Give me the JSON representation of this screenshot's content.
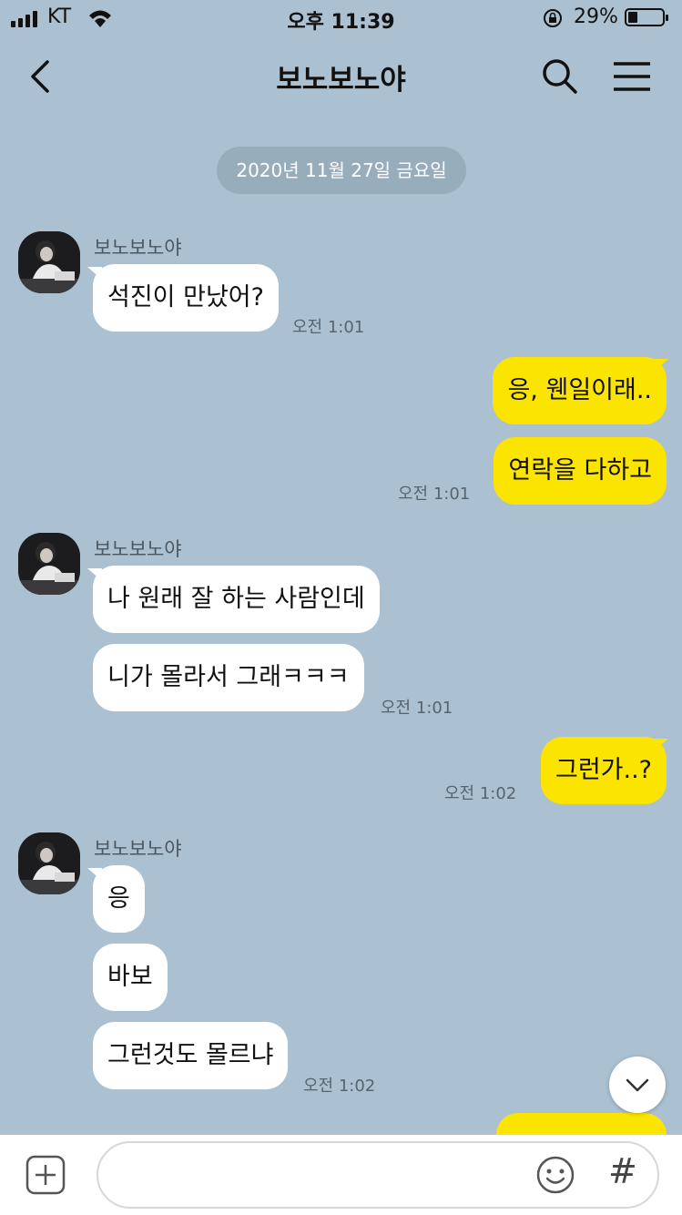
{
  "status_bar": {
    "carrier": "KT",
    "time": "오후 11:39",
    "battery": "29%"
  },
  "header": {
    "title": "보노보노야"
  },
  "date_divider": "2020년 11월 27일 금요일",
  "chat": {
    "sender": "보노보노야",
    "group1": {
      "messages": [
        "석진이 만났어?"
      ],
      "time": "오전 1:01"
    },
    "group2": {
      "messages": [
        "응, 웬일이래..",
        "연락을 다하고"
      ],
      "time": "오전 1:01"
    },
    "group3": {
      "messages": [
        "나 원래 잘 하는 사람인데",
        "니가 몰라서 그래ㅋㅋㅋ"
      ],
      "time": "오전 1:01"
    },
    "group4": {
      "messages": [
        "그런가..?"
      ],
      "time": "오전 1:02"
    },
    "group5": {
      "messages": [
        "응",
        "바보",
        "그런것도 몰르냐"
      ],
      "time": "오전 1:02"
    }
  },
  "input": {
    "placeholder": "",
    "hash_label": "#"
  },
  "icons": [
    "signal-icon",
    "wifi-icon",
    "orientation-lock-icon",
    "battery-icon",
    "back-icon",
    "search-icon",
    "menu-icon",
    "chevron-down-icon",
    "plus-icon",
    "emoji-icon",
    "hash-icon"
  ],
  "colors": {
    "background": "#abc1d1",
    "outgoing_bubble": "#fbe500",
    "incoming_bubble": "#ffffff",
    "date_pill": "#98adbc"
  }
}
